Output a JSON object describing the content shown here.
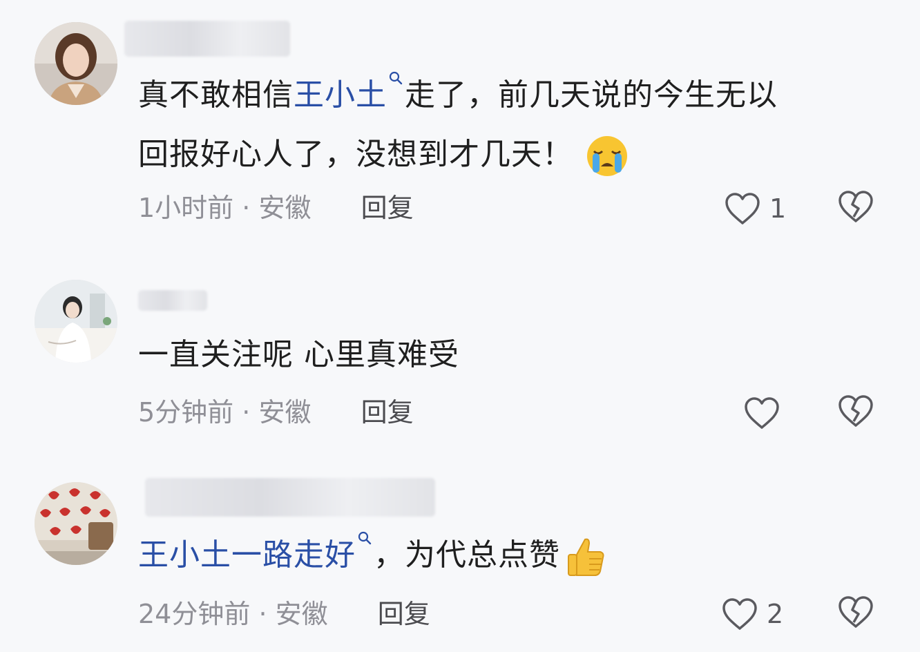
{
  "comments": [
    {
      "text_before": "真不敢相信",
      "link": "王小土",
      "text_after_line1": "走了，前几天说的今生无以",
      "text_line2": "回报好心人了，没想到才几天！",
      "emoji": "crying-face-icon",
      "time": "1小时前",
      "location": "安徽",
      "reply_label": "回复",
      "like_count": "1"
    },
    {
      "text": "一直关注呢  心里真难受",
      "time": "5分钟前",
      "location": "安徽",
      "reply_label": "回复",
      "like_count": ""
    },
    {
      "link": "王小土一路走好",
      "text_after": "，为代总点赞",
      "emoji": "thumbs-up-icon",
      "time": "24分钟前",
      "location": "安徽",
      "reply_label": "回复",
      "like_count": "2"
    }
  ],
  "meta_separator": "·",
  "colors": {
    "background": "#f7f8fa",
    "link": "#2a4fa6",
    "meta": "#8f8f96"
  }
}
